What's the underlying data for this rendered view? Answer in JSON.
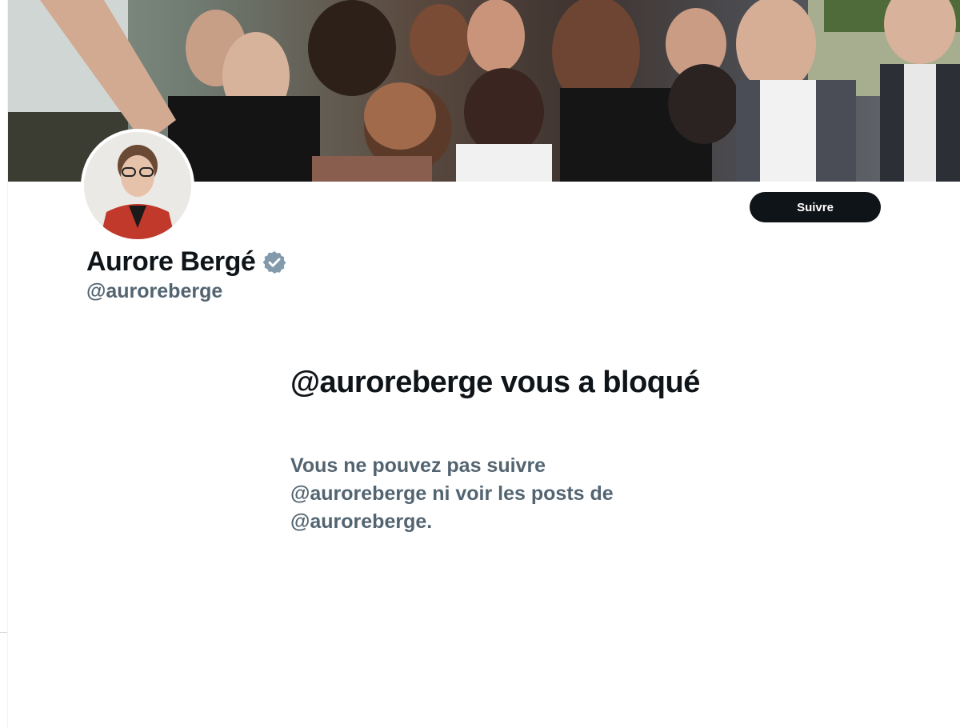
{
  "profile": {
    "display_name": "Aurore Bergé",
    "handle": "@auroreberge",
    "verified": true,
    "verified_icon": "verified-badge-icon"
  },
  "actions": {
    "follow_label": "Suivre"
  },
  "blocked_notice": {
    "title": "@auroreberge vous a bloqué",
    "description": "Vous ne pouvez pas suivre @auroreberge ni voir les posts de @auroreberge."
  },
  "colors": {
    "text_primary": "#0f1419",
    "text_secondary": "#536471",
    "button_bg": "#0f1419",
    "verified_badge": "#829aab"
  }
}
